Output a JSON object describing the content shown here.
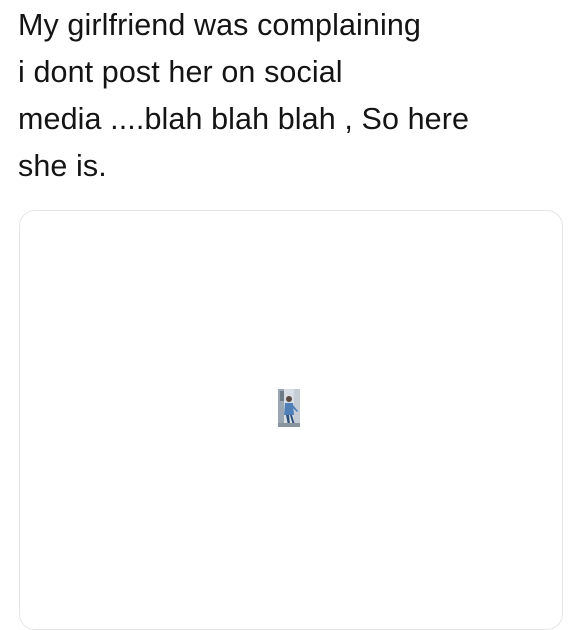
{
  "post": {
    "text_lines": [
      "My girlfriend was complaining",
      "i dont post her on social",
      "media ....blah blah blah , So here",
      "she is."
    ]
  },
  "media": {
    "image_icon": "tiny-photo-thumbnail",
    "colors": {
      "background": "#ffffff",
      "border": "#e6e6e6",
      "text": "#141414"
    }
  }
}
